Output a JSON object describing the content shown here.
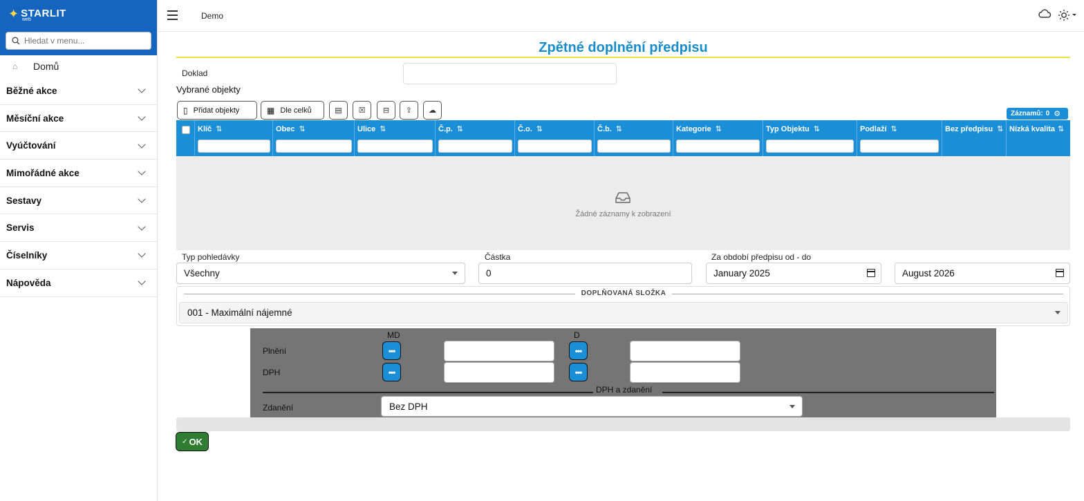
{
  "brand": {
    "name": "STARLIT",
    "sub": "web"
  },
  "search": {
    "placeholder": "Hledat v menu..."
  },
  "sidebar": {
    "home": "Domů",
    "items": [
      {
        "label": "Běžné akce"
      },
      {
        "label": "Měsíční akce"
      },
      {
        "label": "Vyúčtování"
      },
      {
        "label": "Mimořádné akce"
      },
      {
        "label": "Sestavy"
      },
      {
        "label": "Servis"
      },
      {
        "label": "Číselníky"
      },
      {
        "label": "Nápověda"
      }
    ]
  },
  "topbar": {
    "breadcrumb": "Demo"
  },
  "page": {
    "title": "Zpětné doplnění předpisu"
  },
  "form": {
    "doklad_label": "Doklad",
    "doklad_value": "",
    "selected_objects_title": "Vybrané objekty"
  },
  "toolbar": {
    "add_objects": "Přidat objekty",
    "by_units": "Dle celků",
    "records_label": "Záznamů:",
    "records_count": "0"
  },
  "grid": {
    "columns": [
      {
        "label": "Klíč"
      },
      {
        "label": "Obec"
      },
      {
        "label": "Ulice"
      },
      {
        "label": "Č.p."
      },
      {
        "label": "Č.o."
      },
      {
        "label": "Č.b."
      },
      {
        "label": "Kategorie"
      },
      {
        "label": "Typ Objektu"
      },
      {
        "label": "Podlaží"
      },
      {
        "label": "Bez předpisu"
      },
      {
        "label": "Nízká kvalita"
      }
    ],
    "empty_text": "Žádné záznamy k zobrazení",
    "sort_glyph": "⇅"
  },
  "filters": {
    "typ_pohledavky_label": "Typ pohledávky",
    "typ_pohledavky_value": "Všechny",
    "castka_label": "Částka",
    "castka_value": "0",
    "obdobi_label": "Za období předpisu od - do",
    "obdobi_od": "January 2025",
    "obdobi_do": "August 2026"
  },
  "doplnovana": {
    "legend": "DOPLŇOVANÁ SLOŽKA",
    "value": "001 - Maximální nájemné"
  },
  "accounts": {
    "md_label": "MD",
    "d_label": "D",
    "plneni_label": "Plnění",
    "dph_label": "DPH",
    "dots": "•••",
    "section_label": "DPH a zdanění",
    "zdaneni_label": "Zdanění",
    "zdaneni_value": "Bez DPH"
  },
  "ok": {
    "label": "OK"
  },
  "colors": {
    "brand": "#1565c0",
    "accent": "#1a8fd8",
    "title": "#1a8ccc",
    "ok": "#2e7d32"
  }
}
